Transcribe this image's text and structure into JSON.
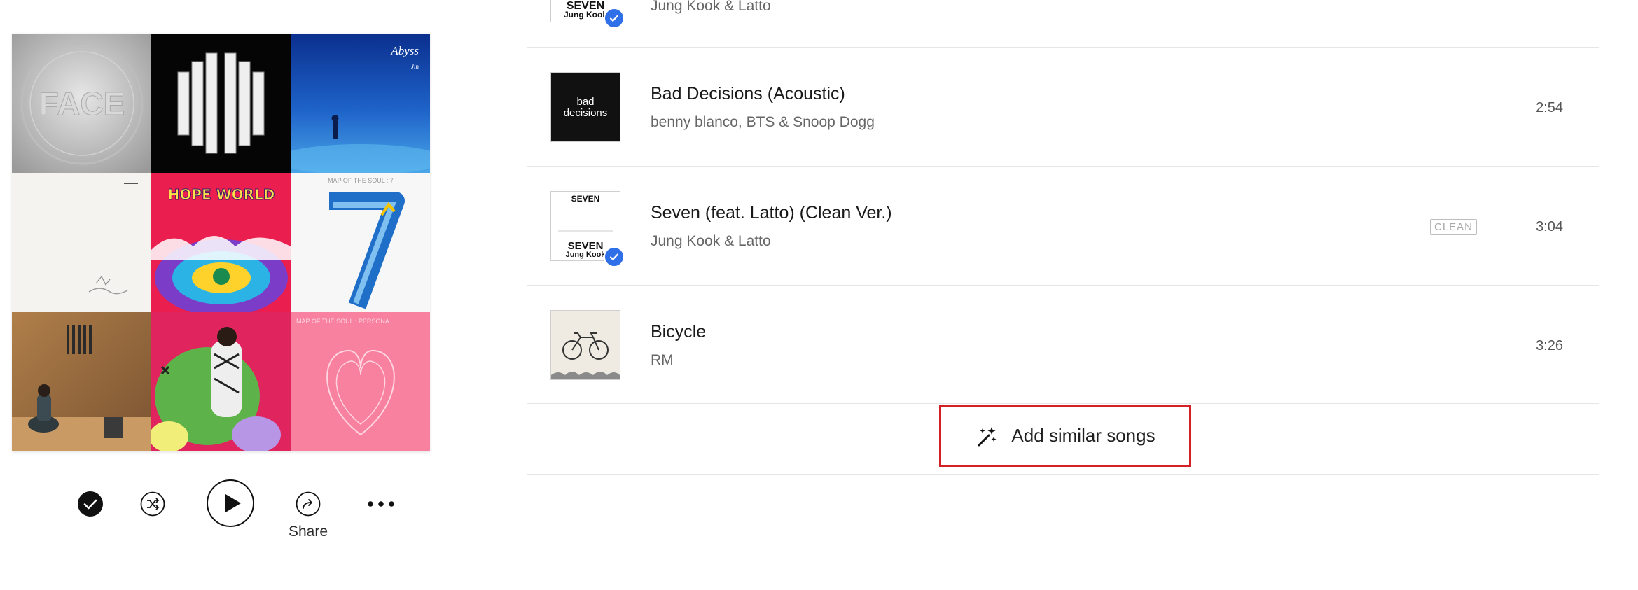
{
  "left_panel": {
    "covers": [
      "face-album-cover",
      "proof-album-cover",
      "abyss-album-cover",
      "rm-indigo-cover",
      "hope-world-cover",
      "map-of-the-soul-7-cover",
      "jung-kook-golden-cover",
      "jhope-kaws-cover",
      "map-of-the-soul-persona-cover"
    ],
    "cover_text": {
      "face": "FACE",
      "abyss": "Abyss",
      "abyss_sub": "Jin",
      "hope_world": "HOPE WORLD",
      "mots7_top": "MAP OF THE SOUL : 7",
      "mots7_number": "7",
      "persona_top": "MAP OF THE SOUL : PERSONA"
    },
    "controls": {
      "share_label": "Share"
    }
  },
  "tracks": [
    {
      "title": "",
      "artist": "Jung Kook & Latto",
      "duration": "",
      "badge": "",
      "thumb_text": "SEVEN",
      "downloaded": true
    },
    {
      "title": "Bad Decisions (Acoustic)",
      "artist": "benny blanco, BTS & Snoop Dogg",
      "duration": "2:54",
      "badge": "",
      "thumb_text": "bad decisions",
      "downloaded": false
    },
    {
      "title": "Seven (feat. Latto) (Clean Ver.)",
      "artist": "Jung Kook & Latto",
      "duration": "3:04",
      "badge": "CLEAN",
      "thumb_text": "SEVEN",
      "downloaded": true
    },
    {
      "title": "Bicycle",
      "artist": "RM",
      "duration": "3:26",
      "badge": "",
      "thumb_text": "",
      "downloaded": false
    }
  ],
  "actions": {
    "add_similar_label": "Add similar songs"
  },
  "colors": {
    "accent_check": "#2f6fe8",
    "highlight_border": "#d32027"
  }
}
